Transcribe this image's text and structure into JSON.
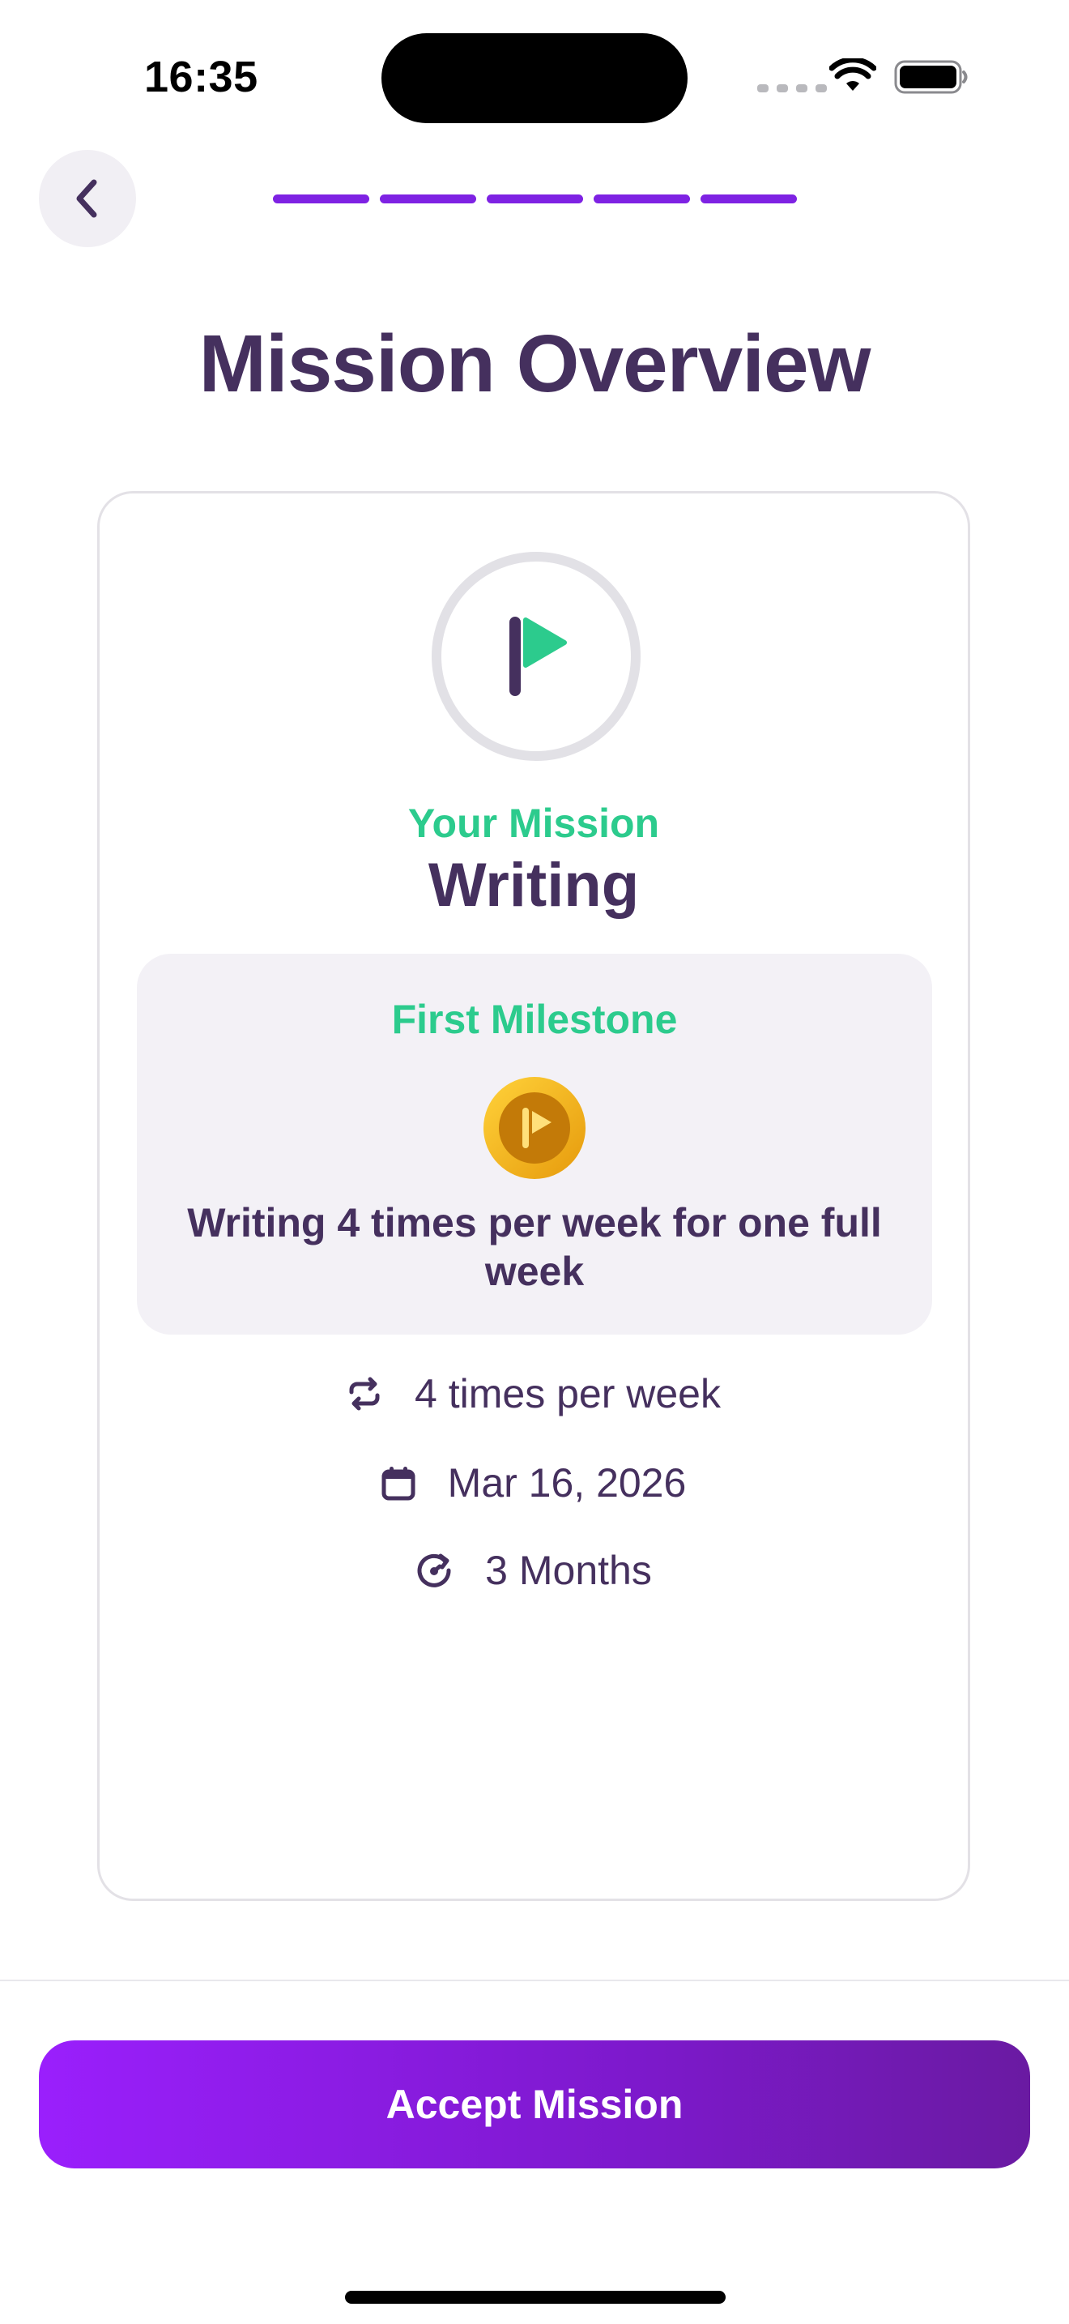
{
  "status_bar": {
    "time": "16:35"
  },
  "nav": {
    "back_icon": "chevron-left-icon",
    "progress": {
      "completed_steps": 5,
      "total_steps": 5
    }
  },
  "title": "Mission Overview",
  "card": {
    "mission_icon": "flag-icon",
    "mission_label": "Your Mission",
    "mission_name": "Writing",
    "milestone": {
      "label": "First Milestone",
      "badge_icon": "gold-coin-flag-icon",
      "description": "Writing 4 times per week for one full week"
    },
    "details": [
      {
        "icon": "repeat-icon",
        "text": "4 times per week"
      },
      {
        "icon": "calendar-icon",
        "text": "Mar 16, 2026"
      },
      {
        "icon": "duration-icon",
        "text": "3 Months"
      }
    ]
  },
  "footer": {
    "accept_label": "Accept Mission"
  },
  "colors": {
    "primary_text": "#45305e",
    "accent_green": "#2ccb8d",
    "accent_purple": "#7e22e3",
    "button_gradient_start": "#9a1ffc",
    "button_gradient_end": "#6a1aa2"
  }
}
